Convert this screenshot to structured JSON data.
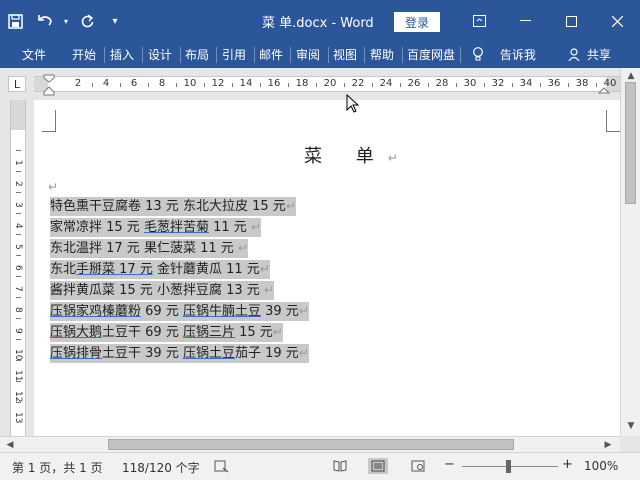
{
  "titlebar": {
    "doc_title": "菜 单.docx - Word",
    "login_label": "登录",
    "colors": {
      "accent": "#2b579a"
    }
  },
  "ribbon": {
    "tabs": [
      "文件",
      "开始",
      "插入",
      "设计",
      "布局",
      "引用",
      "邮件",
      "审阅",
      "视图",
      "帮助",
      "百度网盘"
    ],
    "tell_me": "告诉我",
    "share": "共享"
  },
  "ruler": {
    "corner_label": "L",
    "h_ticks": [
      "2",
      "4",
      "6",
      "8",
      "10",
      "12",
      "14",
      "16",
      "18",
      "20",
      "22",
      "24",
      "26",
      "28",
      "30",
      "32",
      "34",
      "36",
      "38",
      "40"
    ],
    "v_ticks": [
      "1",
      "2",
      "3",
      "4",
      "5",
      "6",
      "7",
      "8",
      "9",
      "10",
      "11",
      "12",
      "13"
    ]
  },
  "document": {
    "title": "菜   单",
    "paragraph_mark": "↵",
    "lines": [
      {
        "segments": [
          {
            "text": "特色熏干豆腐卷 13 元  东北大拉皮 15 元",
            "squig": false
          }
        ],
        "tail": "↵"
      },
      {
        "segments": [
          {
            "text": "家常凉拌 15 元  ",
            "squig": false
          },
          {
            "text": "毛葱拌苦菊",
            "squig": true
          },
          {
            "text": " 11 元  ",
            "squig": false
          }
        ],
        "tail": "↵"
      },
      {
        "segments": [
          {
            "text": "东北温拌 17 元  果仁菠菜 11 元  ",
            "squig": false
          }
        ],
        "tail": "↵"
      },
      {
        "segments": [
          {
            "text": "东北",
            "squig": false
          },
          {
            "text": "手掰菜 17 元",
            "squig": true
          },
          {
            "text": "  金针蘑黄瓜 11 元",
            "squig": false
          }
        ],
        "tail": "↵"
      },
      {
        "segments": [
          {
            "text": "酱拌黄瓜菜 15 元  小葱拌豆腐 13 元  ",
            "squig": false
          }
        ],
        "tail": "↵"
      },
      {
        "segments": [
          {
            "text": "压锅家鸡榛蘑粉",
            "squig": true
          },
          {
            "text": " 69 元  ",
            "squig": false
          },
          {
            "text": "压锅牛腩土豆",
            "squig": true
          },
          {
            "text": " 39 元",
            "squig": false
          }
        ],
        "tail": "↵"
      },
      {
        "segments": [
          {
            "text": "压锅大鹅",
            "squig": true
          },
          {
            "text": "土豆干 69 元  ",
            "squig": false
          },
          {
            "text": "压锅三片",
            "squig": true
          },
          {
            "text": " 15 元",
            "squig": false
          }
        ],
        "tail": "↵"
      },
      {
        "segments": [
          {
            "text": "压锅排骨",
            "squig": true
          },
          {
            "text": "土豆干 39 元  ",
            "squig": false
          },
          {
            "text": "压锅土豆",
            "squig": true
          },
          {
            "text": "茄子 19 元",
            "squig": false
          }
        ],
        "tail": "↵"
      }
    ]
  },
  "statusbar": {
    "page_info": "第 1 页，共 1 页",
    "word_count": "118/120 个字",
    "zoom_minus": "−",
    "zoom_plus": "+",
    "zoom_level": "100%"
  }
}
